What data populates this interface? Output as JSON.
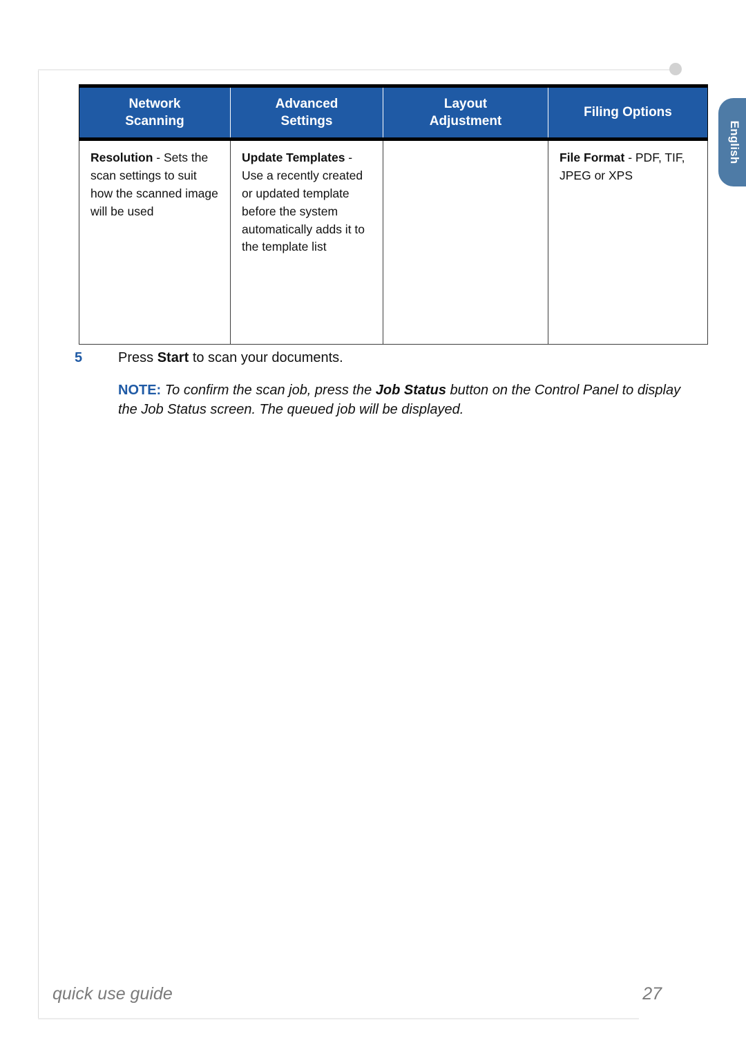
{
  "page": {
    "footer_title": "quick use guide",
    "page_number": "27",
    "language_tab": "English"
  },
  "colors": {
    "header_blue": "#1f5aa5",
    "tab_blue": "#4e7ba6",
    "accent_text": "#1f5aa5",
    "footer_gray": "#7a7a7a",
    "rule_gray": "#ececec",
    "dot_gray": "#d2d2d2"
  },
  "table": {
    "headers": [
      "Network Scanning",
      "Advanced Settings",
      "Layout Adjustment",
      "Filing Options"
    ],
    "header_lines": [
      [
        "Network",
        "Scanning"
      ],
      [
        "Advanced",
        "Settings"
      ],
      [
        "Layout",
        "Adjustment"
      ],
      [
        "Filing Options"
      ]
    ],
    "rows": [
      {
        "cells": [
          {
            "term": "Resolution",
            "description": " - Sets the scan settings to suit how the scanned image will be used"
          },
          {
            "term": "Update Templates",
            "description": " - Use a recently created or updated template before the system automatically adds it to the template list"
          },
          {
            "term": "",
            "description": ""
          },
          {
            "term": "File Format",
            "description": " - PDF, TIF, JPEG or XPS"
          }
        ]
      }
    ]
  },
  "step": {
    "number": "5",
    "text_before": "Press ",
    "bold_term": "Start",
    "text_after": " to scan your documents."
  },
  "note": {
    "label": "NOTE:",
    "text_before": " To confirm the scan job, press the ",
    "bold_term": "Job Status",
    "text_after": " button on the Control Panel to display the Job Status screen. The queued job will be displayed."
  }
}
